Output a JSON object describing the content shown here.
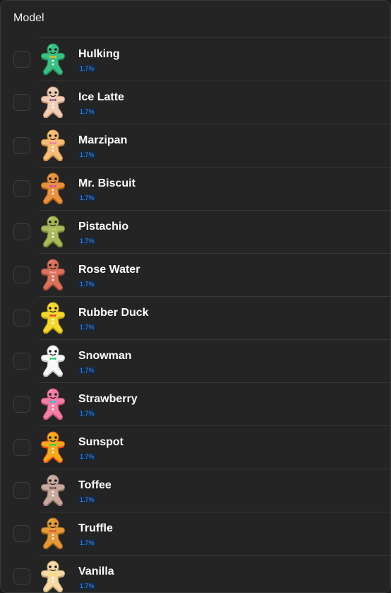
{
  "header": {
    "title": "Model"
  },
  "items": [
    {
      "label": "Hulking",
      "pct": "1.7%",
      "color": "#3cbf84",
      "shade": "#1f8f5c",
      "bow": "#f0c020"
    },
    {
      "label": "Ice Latte",
      "pct": "1.7%",
      "color": "#f2cdb6",
      "shade": "#c99a82",
      "bow": "#7a5a86"
    },
    {
      "label": "Marzipan",
      "pct": "1.7%",
      "color": "#f6bd78",
      "shade": "#c98f4a",
      "bow": "#f07fa6"
    },
    {
      "label": "Mr. Biscuit",
      "pct": "1.7%",
      "color": "#e8913e",
      "shade": "#b0661c",
      "bow": "#e24aa8"
    },
    {
      "label": "Pistachio",
      "pct": "1.7%",
      "color": "#a9b85a",
      "shade": "#7a8a34",
      "bow": "#b8d070"
    },
    {
      "label": "Rose Water",
      "pct": "1.7%",
      "color": "#d9735a",
      "shade": "#a84a36",
      "bow": "#f3a0a0"
    },
    {
      "label": "Rubber Duck",
      "pct": "1.7%",
      "color": "#f3d832",
      "shade": "#c7a816",
      "bow": "#e8402a"
    },
    {
      "label": "Snowman",
      "pct": "1.7%",
      "color": "#f7f7f7",
      "shade": "#c8c8c8",
      "bow": "#2cc46a"
    },
    {
      "label": "Strawberry",
      "pct": "1.7%",
      "color": "#f27fa6",
      "shade": "#c4547c",
      "bow": "#48b4e6"
    },
    {
      "label": "Sunspot",
      "pct": "1.7%",
      "color": "#f5a91c",
      "shade": "#e0501c",
      "bow": "#3cc44a"
    },
    {
      "label": "Toffee",
      "pct": "1.7%",
      "color": "#c9a89e",
      "shade": "#997870",
      "bow": "#6a4a40"
    },
    {
      "label": "Truffle",
      "pct": "1.7%",
      "color": "#e59a3a",
      "shade": "#a8681c",
      "bow": "#e24a4a"
    },
    {
      "label": "Vanilla",
      "pct": "1.7%",
      "color": "#f7d9a6",
      "shade": "#c9ad7a",
      "bow": "#f0e060"
    }
  ]
}
